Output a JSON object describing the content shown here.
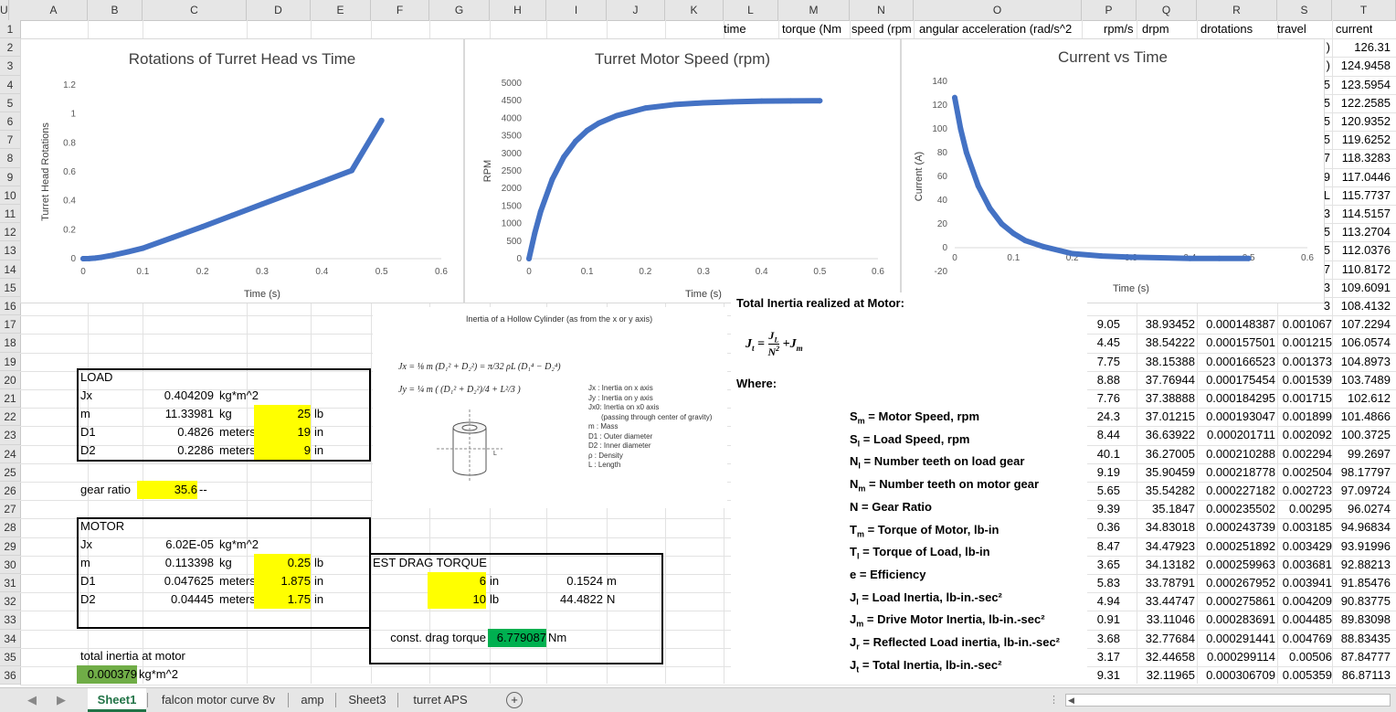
{
  "columns": [
    "A",
    "B",
    "C",
    "D",
    "E",
    "F",
    "G",
    "H",
    "I",
    "J",
    "K",
    "L",
    "M",
    "N",
    "O",
    "P",
    "Q",
    "R",
    "S",
    "T",
    "U"
  ],
  "rows": [
    "1",
    "2",
    "3",
    "4",
    "5",
    "6",
    "7",
    "8",
    "9",
    "10",
    "11",
    "12",
    "13",
    "14",
    "15",
    "16",
    "17",
    "18",
    "19",
    "20",
    "21",
    "22",
    "23",
    "24",
    "25",
    "26",
    "27",
    "28",
    "29",
    "30",
    "31",
    "32",
    "33",
    "34",
    "35",
    "36"
  ],
  "header_row": {
    "M": "time",
    "N": "torque (Nm",
    "O": "speed (rpm",
    "P": "angular acceleration (rad/s^2",
    "Q": "rpm/s",
    "R": "drpm",
    "S": "drotations",
    "T": "travel",
    "U": "current"
  },
  "col_u_partial": [
    "126.31",
    "124.9458",
    "123.5954",
    "122.2585",
    "120.9352",
    "119.6252",
    "118.3283",
    "117.0446",
    "115.7737",
    "114.5157",
    "113.2704",
    "112.0376",
    "110.8172",
    "109.6091",
    "108.4132"
  ],
  "col_t_stubs": [
    ")",
    ")",
    "5",
    "5",
    "5",
    "5",
    "7",
    "9",
    "L",
    "3",
    "5",
    "5",
    "7",
    "3",
    "3"
  ],
  "lower_table": [
    [
      "9.05",
      "38.93452",
      "0.000148387",
      "0.001067",
      "107.2294"
    ],
    [
      "4.45",
      "38.54222",
      "0.000157501",
      "0.001215",
      "106.0574"
    ],
    [
      "7.75",
      "38.15388",
      "0.000166523",
      "0.001373",
      "104.8973"
    ],
    [
      "8.88",
      "37.76944",
      "0.000175454",
      "0.001539",
      "103.7489"
    ],
    [
      "7.76",
      "37.38888",
      "0.000184295",
      "0.001715",
      "102.612"
    ],
    [
      "24.3",
      "37.01215",
      "0.000193047",
      "0.001899",
      "101.4866"
    ],
    [
      "8.44",
      "36.63922",
      "0.000201711",
      "0.002092",
      "100.3725"
    ],
    [
      "40.1",
      "36.27005",
      "0.000210288",
      "0.002294",
      "99.2697"
    ],
    [
      "9.19",
      "35.90459",
      "0.000218778",
      "0.002504",
      "98.17797"
    ],
    [
      "5.65",
      "35.54282",
      "0.000227182",
      "0.002723",
      "97.09724"
    ],
    [
      "9.39",
      "35.1847",
      "0.000235502",
      "0.00295",
      "96.0274"
    ],
    [
      "0.36",
      "34.83018",
      "0.000243739",
      "0.003185",
      "94.96834"
    ],
    [
      "8.47",
      "34.47923",
      "0.000251892",
      "0.003429",
      "93.91996"
    ],
    [
      "3.65",
      "34.13182",
      "0.000259963",
      "0.003681",
      "92.88213"
    ],
    [
      "5.83",
      "33.78791",
      "0.000267952",
      "0.003941",
      "91.85476"
    ],
    [
      "4.94",
      "33.44747",
      "0.000275861",
      "0.004209",
      "90.83775"
    ],
    [
      "0.91",
      "33.11046",
      "0.000283691",
      "0.004485",
      "89.83098"
    ],
    [
      "3.68",
      "32.77684",
      "0.000291441",
      "0.004769",
      "88.83435"
    ],
    [
      "3.17",
      "32.44658",
      "0.000299114",
      "0.00506",
      "87.84777"
    ],
    [
      "9.31",
      "32.11965",
      "0.000306709",
      "0.005359",
      "86.87113"
    ]
  ],
  "load": {
    "title": "LOAD",
    "jx_label": "Jx",
    "jx_val": "0.404209",
    "jx_unit": "kg*m^2",
    "m_label": "m",
    "m_val": "11.33981",
    "m_unit": "kg",
    "m_in": "25",
    "m_in_unit": "lb",
    "d1_label": "D1",
    "d1_val": "0.4826",
    "d1_unit": "meters",
    "d1_in": "19",
    "d1_in_unit": "in",
    "d2_label": "D2",
    "d2_val": "0.2286",
    "d2_unit": "meters",
    "d2_in": "9",
    "d2_in_unit": "in"
  },
  "gear": {
    "label": "gear ratio",
    "value": "35.6",
    "unit": "--"
  },
  "motor": {
    "title": "MOTOR",
    "jx_label": "Jx",
    "jx_val": "6.02E-05",
    "jx_unit": "kg*m^2",
    "m_label": "m",
    "m_val": "0.113398",
    "m_unit": "kg",
    "m_in": "0.25",
    "m_in_unit": "lb",
    "d1_label": "D1",
    "d1_val": "0.047625",
    "d1_unit": "meters",
    "d1_in": "1.875",
    "d1_in_unit": "in",
    "d2_label": "D2",
    "d2_val": "0.04445",
    "d2_unit": "meters",
    "d2_in": "1.75",
    "d2_in_unit": "in"
  },
  "drag": {
    "title": "EST DRAG TORQUE",
    "r_in": "6",
    "r_in_unit": "in",
    "r_m": "0.1524",
    "r_m_unit": "m",
    "f_lb": "10",
    "f_lb_unit": "lb",
    "f_n": "44.4822",
    "f_n_unit": "N",
    "const_label": "const. drag torque",
    "const_val": "6.779087",
    "const_unit": "Nm"
  },
  "total_inertia": {
    "label": "total inertia at motor",
    "value": "0.000379",
    "unit": "kg*m^2"
  },
  "inertia_figure": {
    "title": "Inertia of a Hollow Cylinder (as from the x or y axis)",
    "legend": [
      "Jx : Inertia on x axis",
      "Jy : Inertia on y axis",
      "Jx0: Inertia on x0 axis",
      "(passing through center of gravity)",
      "m : Mass",
      "D1 : Outer diameter",
      "D2 : Inner diameter",
      "ρ : Density",
      "L : Length"
    ]
  },
  "equations": {
    "heading": "Total Inertia realized at Motor:",
    "where": "Where:",
    "defs": [
      {
        "sym": "S",
        "sub": "m",
        "text": "Motor Speed, rpm"
      },
      {
        "sym": "S",
        "sub": "l",
        "text": "Load Speed, rpm"
      },
      {
        "sym": "N",
        "sub": "l",
        "text": "Number teeth on load gear"
      },
      {
        "sym": "N",
        "sub": "m",
        "text": "Number teeth on motor gear"
      },
      {
        "sym": "N",
        "sub": "",
        "text": "Gear Ratio"
      },
      {
        "sym": "T",
        "sub": "m",
        "text": "Torque of Motor, lb-in"
      },
      {
        "sym": "T",
        "sub": "l",
        "text": "Torque of Load, lb-in"
      },
      {
        "sym": "e",
        "sub": "",
        "text": "Efficiency"
      },
      {
        "sym": "J",
        "sub": "l",
        "text": "Load Inertia, lb-in.-sec²"
      },
      {
        "sym": "J",
        "sub": "m",
        "text": "Drive Motor Inertia, lb-in.-sec²"
      },
      {
        "sym": "J",
        "sub": "r",
        "text": "Reflected Load inertia, lb-in.-sec²"
      },
      {
        "sym": "J",
        "sub": "t",
        "text": "Total Inertia, lb-in.-sec²"
      }
    ]
  },
  "tabs": [
    "Sheet1",
    "falcon motor curve 8v",
    "amp",
    "Sheet3",
    "turret APS"
  ],
  "active_tab": "Sheet1",
  "add_sheet": "+",
  "chart_data": [
    {
      "type": "line",
      "title": "Rotations of Turret Head vs Time",
      "xlabel": "Time (s)",
      "ylabel": "Turret Head Rotations",
      "xlim": [
        0,
        0.6
      ],
      "ylim": [
        0,
        1.2
      ],
      "xticks": [
        "0",
        "0.1",
        "0.2",
        "0.3",
        "0.4",
        "0.5",
        "0.6"
      ],
      "yticks": [
        "0",
        "0.2",
        "0.4",
        "0.6",
        "0.8",
        "1",
        "1.2"
      ],
      "x": [
        0,
        0.01,
        0.02,
        0.03,
        0.05,
        0.075,
        0.1,
        0.15,
        0.2,
        0.25,
        0.3,
        0.35,
        0.4,
        0.45,
        0.5
      ],
      "y": [
        0,
        0.001,
        0.004,
        0.009,
        0.024,
        0.047,
        0.072,
        0.146,
        0.221,
        0.299,
        0.377,
        0.454,
        0.531,
        0.609,
        0.955
      ],
      "color": "#4472c4"
    },
    {
      "type": "line",
      "title": "Turret Motor Speed (rpm)",
      "xlabel": "Time (s)",
      "ylabel": "RPM",
      "xlim": [
        0,
        0.6
      ],
      "ylim": [
        0,
        5000
      ],
      "xticks": [
        "0",
        "0.1",
        "0.2",
        "0.3",
        "0.4",
        "0.5",
        "0.6"
      ],
      "yticks": [
        "0",
        "500",
        "1000",
        "1500",
        "2000",
        "2500",
        "3000",
        "3500",
        "4000",
        "4500",
        "5000"
      ],
      "x": [
        0,
        0.01,
        0.02,
        0.04,
        0.06,
        0.08,
        0.1,
        0.12,
        0.15,
        0.2,
        0.25,
        0.3,
        0.35,
        0.4,
        0.45,
        0.5
      ],
      "y": [
        0,
        730,
        1340,
        2260,
        2900,
        3340,
        3650,
        3860,
        4070,
        4290,
        4390,
        4440,
        4470,
        4490,
        4495,
        4500
      ],
      "color": "#4472c4"
    },
    {
      "type": "line",
      "title": "Current vs Time",
      "xlabel": "Time (s)",
      "ylabel": "Current (A)",
      "xlim": [
        0,
        0.6
      ],
      "ylim": [
        -20,
        140
      ],
      "xticks": [
        "0",
        "0.1",
        "0.2",
        "0.3",
        "0.4",
        "0.5",
        "0.6"
      ],
      "yticks": [
        "-20",
        "0",
        "20",
        "40",
        "60",
        "80",
        "100",
        "120",
        "140"
      ],
      "x": [
        0,
        0.01,
        0.02,
        0.04,
        0.06,
        0.08,
        0.1,
        0.12,
        0.15,
        0.2,
        0.25,
        0.3,
        0.35,
        0.4,
        0.45,
        0.5
      ],
      "y": [
        126.3,
        100,
        80,
        52,
        33,
        20,
        12,
        6,
        1,
        -5,
        -7,
        -8,
        -8.5,
        -9,
        -9,
        -9
      ],
      "color": "#4472c4"
    }
  ]
}
